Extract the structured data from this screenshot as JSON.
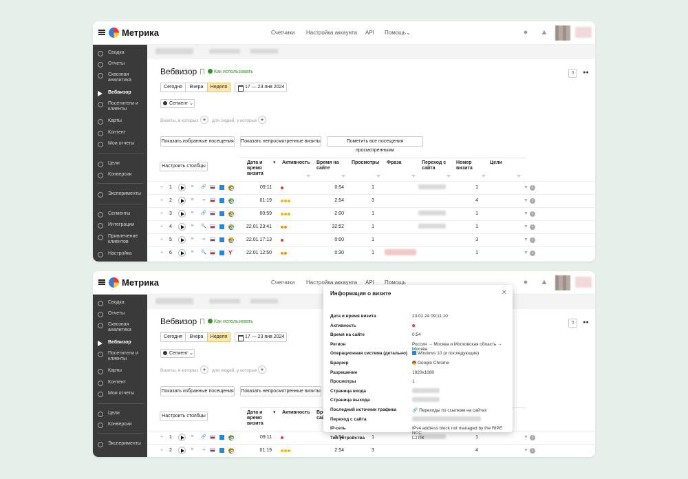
{
  "app": {
    "brand": "Метрика",
    "nav": [
      "Счетчики",
      "Настройка аккаунта",
      "API",
      "Помощь"
    ]
  },
  "sidebar": {
    "items": [
      {
        "label": "Сводка",
        "icon": "gauge-icon"
      },
      {
        "label": "Отчеты",
        "icon": "pie-icon"
      },
      {
        "label": "Сквозная аналитика",
        "icon": "gear-icon"
      },
      {
        "label": "Вебвизор",
        "icon": "play-icon",
        "active": true
      },
      {
        "label": "Посетители и клиенты",
        "icon": "user-icon"
      },
      {
        "label": "Карты",
        "icon": "map-icon"
      },
      {
        "label": "Контент",
        "icon": "pen-icon"
      },
      {
        "label": "Мои отчеты",
        "icon": "list-icon"
      },
      {
        "label": "Цели",
        "icon": "target-icon"
      },
      {
        "label": "Конверсии",
        "icon": "conversion-icon"
      },
      {
        "label": "Эксперименты",
        "icon": "flask-icon"
      },
      {
        "label": "Сегменты",
        "icon": "segment-icon"
      },
      {
        "label": "Интеграции",
        "icon": "puzzle-icon"
      },
      {
        "label": "Привлечение клиентов",
        "icon": "fire-icon"
      },
      {
        "label": "Настройка",
        "icon": "gear-icon"
      }
    ]
  },
  "page": {
    "title": "Вебвизор",
    "howto": "Как использовать",
    "periods": [
      "Сегодня",
      "Вчера",
      "Неделя"
    ],
    "selected_period": "Неделя",
    "date_range": "17 — 23 янв 2024",
    "segment": "Сегмент",
    "cond1": "Визиты, в которых",
    "cond2": "для людей, у которых",
    "actions": [
      "Показать избранные посещения",
      "Показать непросмотренные визиты",
      "Пометить все посещения просмотренными"
    ],
    "columns_button": "Настроить столбцы"
  },
  "table": {
    "headers": [
      "Дата и время визита",
      "Активность",
      "Время на сайте",
      "Просмотры",
      "Фраза",
      "Переход с сайта",
      "Номер визита",
      "Цели"
    ],
    "rows": [
      {
        "n": "1",
        "datetime": "09:11",
        "activity": [
          "r"
        ],
        "time": "0:54",
        "views": "1",
        "visit": "1",
        "src": "link",
        "browser": "chrome"
      },
      {
        "n": "2",
        "datetime": "01:19",
        "activity": [
          "y",
          "y",
          "y"
        ],
        "time": "2:54",
        "views": "3",
        "visit": "4",
        "src": "direct",
        "browser": "chrome"
      },
      {
        "n": "3",
        "datetime": "00:59",
        "activity": [
          "y",
          "y",
          "y"
        ],
        "time": "2:00",
        "views": "1",
        "visit": "1",
        "src": "link",
        "browser": "chrome"
      },
      {
        "n": "4",
        "datetime": "22.01 23:41",
        "activity": [
          "o",
          "o"
        ],
        "time": "32:52",
        "views": "1",
        "visit": "1",
        "src": "search",
        "browser": "chrome"
      },
      {
        "n": "5",
        "datetime": "22.01 17:13",
        "activity": [
          "r"
        ],
        "time": "0:00",
        "views": "1",
        "visit": "3",
        "src": "direct",
        "browser": "chrome"
      },
      {
        "n": "6",
        "datetime": "22.01 12:50",
        "activity": [
          "o",
          "o"
        ],
        "time": "0:30",
        "views": "1",
        "visit": "1",
        "src": "search",
        "browser": "yandex"
      }
    ]
  },
  "popup": {
    "title": "Информация о визите",
    "fields": [
      {
        "k": "Дата и время визита",
        "v": "23.01.24 09:11:10"
      },
      {
        "k": "Активность",
        "v": ""
      },
      {
        "k": "Время на сайте",
        "v": "0:54"
      },
      {
        "k": "Регион",
        "v": "Россия → Москва и Московская область → Москва"
      },
      {
        "k": "Операционная система (детально)",
        "v": "Windows 10 (и последующие)"
      },
      {
        "k": "Браузер",
        "v": "Google Chrome"
      },
      {
        "k": "Разрешение",
        "v": "1920x1080"
      },
      {
        "k": "Просмотры",
        "v": "1"
      },
      {
        "k": "Страница входа",
        "v": ""
      },
      {
        "k": "Страница выхода",
        "v": ""
      },
      {
        "k": "Последний источник трафика",
        "v": "Переходы по ссылкам на сайтах"
      },
      {
        "k": "Переход с сайта",
        "v": ""
      },
      {
        "k": "IP-сеть",
        "v": "IPv4 address block not managed by the RIPE NCC"
      },
      {
        "k": "Тип устройства",
        "v": "ПК"
      }
    ]
  }
}
